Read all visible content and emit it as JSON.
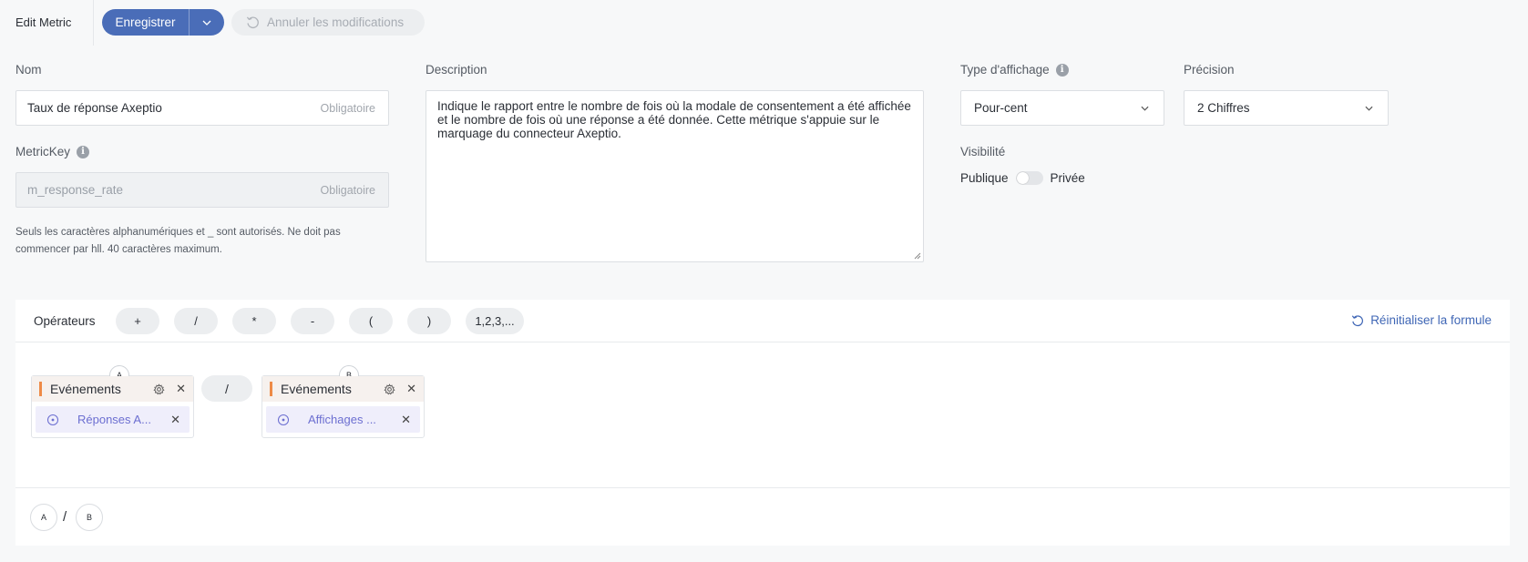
{
  "header": {
    "title": "Edit Metric",
    "save_label": "Enregistrer",
    "cancel_label": "Annuler les modifications"
  },
  "name_field": {
    "label": "Nom",
    "value": "Taux de réponse Axeptio",
    "required": "Obligatoire"
  },
  "metrickey_field": {
    "label": "MetricKey",
    "value": "m_response_rate",
    "required": "Obligatoire",
    "help": "Seuls les caractères alphanumériques et _ sont autorisés. Ne doit pas commencer par hll. 40 caractères maximum."
  },
  "description_field": {
    "label": "Description",
    "value": "Indique le rapport entre le nombre de fois où la modale de consentement a été affichée et le nombre de fois où une réponse a été donnée. Cette métrique s'appuie sur le marquage du connecteur Axeptio."
  },
  "display_type": {
    "label": "Type d'affichage",
    "value": "Pour-cent"
  },
  "precision": {
    "label": "Précision",
    "value": "2 Chiffres"
  },
  "visibility": {
    "label": "Visibilité",
    "public_label": "Publique",
    "private_label": "Privée",
    "is_private": false
  },
  "formula": {
    "operators_label": "Opérateurs",
    "operators": [
      "+",
      "/",
      "*",
      "-",
      "(",
      ")",
      "1,2,3,..."
    ],
    "reset_label": "Réinitialiser la formule",
    "operand_a": {
      "letter": "A",
      "title": "Evénements",
      "chip": "Réponses A..."
    },
    "operator": "/",
    "operand_b": {
      "letter": "B",
      "title": "Evénements",
      "chip": "Affichages ..."
    },
    "summary": {
      "left": "A",
      "op": "/",
      "right": "B"
    }
  },
  "colors": {
    "primary": "#4a6db8",
    "accent_bar": "#ee8b47",
    "chip_text": "#6c6fd1",
    "link": "#3f66b5"
  }
}
